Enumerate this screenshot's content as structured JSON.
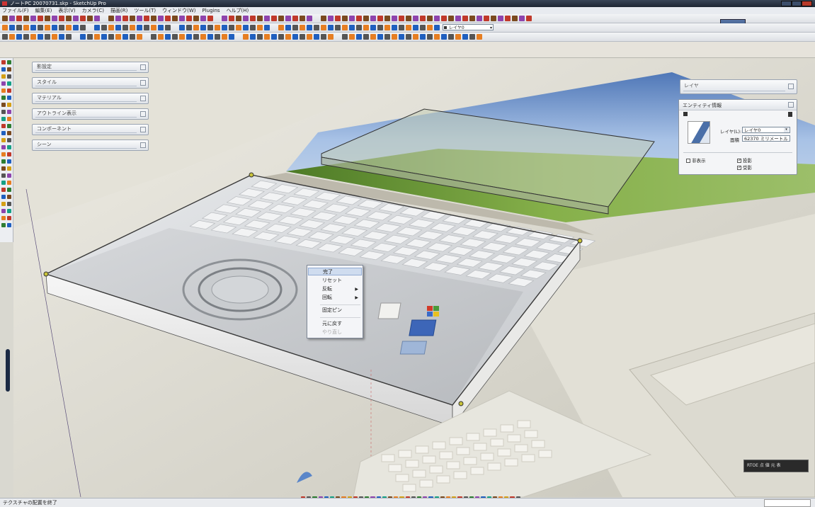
{
  "window": {
    "title": "ノートPC 20070731.skp - SketchUp Pro"
  },
  "menu": [
    "ファイル(F)",
    "編集(E)",
    "表示(V)",
    "カメラ(C)",
    "描画(R)",
    "ツール(T)",
    "ウィンドウ(W)",
    "Plugins",
    "ヘルプ(H)"
  ],
  "toolbar": {
    "layer_select_value": "レイヤ0"
  },
  "trays": [
    {
      "label": "影設定"
    },
    {
      "label": "スタイル"
    },
    {
      "label": "マテリアル"
    },
    {
      "label": "アウトライン表示"
    },
    {
      "label": "コンポーネント"
    },
    {
      "label": "シーン"
    }
  ],
  "layer_panel": {
    "title": "レイヤ"
  },
  "entity_panel": {
    "title": "エンティティ情報",
    "layer_label": "レイヤ(L):",
    "layer_value": "レイヤ0",
    "area_label": "面積",
    "area_value": "62370 ミリメートル",
    "hidden_label": "非表示",
    "cast_label": "投影",
    "receive_label": "受影"
  },
  "context_menu": {
    "items": [
      "完了",
      "リセット",
      "反転",
      "回転",
      "固定ピン",
      "元に戻す",
      "やり直し"
    ]
  },
  "status": {
    "text": "テクスチャの配置を終了"
  },
  "zoom": {
    "label": "RTOE 点 値 元 表"
  },
  "colors": {
    "selected_edge": "#3a3a3a",
    "menu_highlight": "#cfdcef",
    "sky": "#6f93c9",
    "grass": "#6e9a3b"
  }
}
